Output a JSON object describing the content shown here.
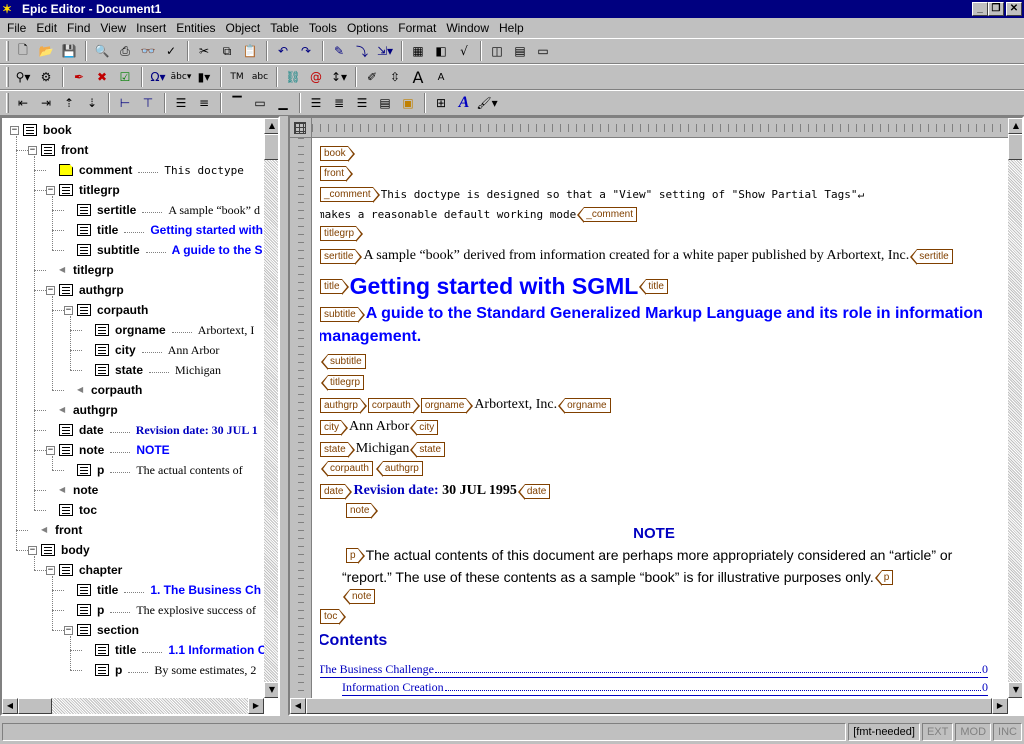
{
  "window": {
    "title": "Epic Editor - Document1"
  },
  "menu": [
    "File",
    "Edit",
    "Find",
    "View",
    "Insert",
    "Entities",
    "Object",
    "Table",
    "Tools",
    "Options",
    "Format",
    "Window",
    "Help"
  ],
  "toolbar_icons": {
    "row1": [
      "new-icon",
      "open-icon",
      "save-icon",
      "print-preview-icon",
      "print-icon",
      "find-icon",
      "spellcheck-icon",
      "cut-icon",
      "copy-icon",
      "paste-icon",
      "undo-icon",
      "redo-icon",
      "insert-markup-icon",
      "insert-special-icon",
      "insert-tag-icon",
      "table-icon",
      "graphic-icon",
      "equation-icon",
      "preview-icon",
      "split-view-icon",
      "full-view-icon"
    ],
    "row2": [
      "change-tag-icon",
      "modify-attributes-icon",
      "pick-tag-icon",
      "delete-markup-icon",
      "check-icon",
      "insert-char-icon",
      "abbrev-icon",
      "paste-element-icon",
      "text-entity-icon",
      "sdata-icon",
      "link-icon",
      "hyperlink-icon",
      "line-spacing-icon",
      "markup-icon",
      "label-icon",
      "font-size-up-icon",
      "font-size-down-icon"
    ],
    "row3": [
      "indent-left-icon",
      "indent-right-icon",
      "move-up-icon",
      "move-down-icon",
      "promote-icon",
      "demote-icon",
      "split-icon",
      "join-icon",
      "frame-top-icon",
      "frame-middle-icon",
      "frame-bottom-icon",
      "align-left-icon",
      "align-center-icon",
      "align-right-icon",
      "justify-icon",
      "insert-image-icon",
      "table-grid-icon",
      "italic-font-icon",
      "paint-icon"
    ]
  },
  "tree": [
    {
      "name": "book",
      "val": "",
      "kind": "el",
      "exp": "-"
    },
    {
      "name": "front",
      "val": "",
      "kind": "el",
      "exp": "-"
    },
    {
      "name": "comment",
      "val": "This doctype",
      "kind": "cmt",
      "exp": "",
      "style": "mono"
    },
    {
      "name": "titlegrp",
      "val": "",
      "kind": "el",
      "exp": "-"
    },
    {
      "name": "sertitle",
      "val": "A sample “book” d",
      "kind": "el",
      "exp": "",
      "style": "serif"
    },
    {
      "name": "title",
      "val": "Getting started with",
      "kind": "el",
      "exp": "",
      "style": "blue"
    },
    {
      "name": "subtitle",
      "val": "A guide to the S",
      "kind": "el",
      "exp": "",
      "style": "blue"
    },
    {
      "name": "titlegrp",
      "val": "",
      "kind": "end",
      "exp": ""
    },
    {
      "name": "authgrp",
      "val": "",
      "kind": "el",
      "exp": "-"
    },
    {
      "name": "corpauth",
      "val": "",
      "kind": "el",
      "exp": "-"
    },
    {
      "name": "orgname",
      "val": "Arbortext, I",
      "kind": "el",
      "exp": "",
      "style": "serif"
    },
    {
      "name": "city",
      "val": "Ann Arbor",
      "kind": "el",
      "exp": "",
      "style": "serif"
    },
    {
      "name": "state",
      "val": "Michigan",
      "kind": "el",
      "exp": "",
      "style": "serif"
    },
    {
      "name": "corpauth",
      "val": "",
      "kind": "end",
      "exp": ""
    },
    {
      "name": "authgrp",
      "val": "",
      "kind": "end",
      "exp": ""
    },
    {
      "name": "date",
      "val": "Revision date: 30 JUL 1",
      "kind": "el",
      "exp": "",
      "style": "bluebold"
    },
    {
      "name": "note",
      "val": "NOTE",
      "kind": "el",
      "exp": "-",
      "style": "blue"
    },
    {
      "name": "p",
      "val": "The actual contents of",
      "kind": "el",
      "exp": "",
      "style": "plain"
    },
    {
      "name": "note",
      "val": "",
      "kind": "end",
      "exp": ""
    },
    {
      "name": "toc",
      "val": "",
      "kind": "el",
      "exp": ""
    },
    {
      "name": "front",
      "val": "",
      "kind": "end",
      "exp": ""
    },
    {
      "name": "body",
      "val": "",
      "kind": "el",
      "exp": "-"
    },
    {
      "name": "chapter",
      "val": "",
      "kind": "el",
      "exp": "-"
    },
    {
      "name": "title",
      "val": "1. The Business Ch",
      "kind": "el",
      "exp": "",
      "style": "blue"
    },
    {
      "name": "p",
      "val": "The explosive success of",
      "kind": "el",
      "exp": "",
      "style": "serif"
    },
    {
      "name": "section",
      "val": "",
      "kind": "el",
      "exp": "-"
    },
    {
      "name": "title",
      "val": "1.1 Information C",
      "kind": "el",
      "exp": "",
      "style": "blue"
    },
    {
      "name": "p",
      "val": "By some estimates, 2",
      "kind": "el",
      "exp": "",
      "style": "serif"
    }
  ],
  "doc": {
    "tags": {
      "book": "book",
      "front": "front",
      "comment": "_comment",
      "titlegrp": "titlegrp",
      "sertitle": "sertitle",
      "title": "title",
      "subtitle": "subtitle",
      "authgrp": "authgrp",
      "corpauth": "corpauth",
      "orgname": "orgname",
      "city": "city",
      "state": "state",
      "date": "date",
      "note": "note",
      "p": "p",
      "toc": "toc"
    },
    "comment_line1": "This doctype is designed so that a \"View\" setting of \"Show Partial Tags\"↵",
    "comment_line2": "makes a reasonable default working mode",
    "sertitle": "A sample “book” derived from information created for a white paper published by Arbortext, Inc.",
    "title": "Getting started with SGML",
    "subtitle_line1": "A guide to the Standard Generalized Markup Language and its role in information",
    "subtitle_line2": "management.",
    "orgname": "Arbortext, Inc.",
    "city": "Ann Arbor",
    "state": "Michigan",
    "date_label": "Revision date:",
    "date_value": "30 JUL 1995",
    "note_heading": "NOTE",
    "p_line1": "The actual contents of this document are perhaps more appropriately considered an “article” or",
    "p_line2": "“report.” The use of these contents as a sample “book” is for illustrative purposes only.",
    "contents_heading": "Contents",
    "toc_entries": [
      {
        "label": "The Business Challenge",
        "page": "00"
      },
      {
        "label": "Information Creation",
        "page": "00"
      }
    ]
  },
  "status": {
    "fmt": "[fmt-needed]",
    "ext": "EXT",
    "mod": "MOD",
    "inc": "INC"
  }
}
